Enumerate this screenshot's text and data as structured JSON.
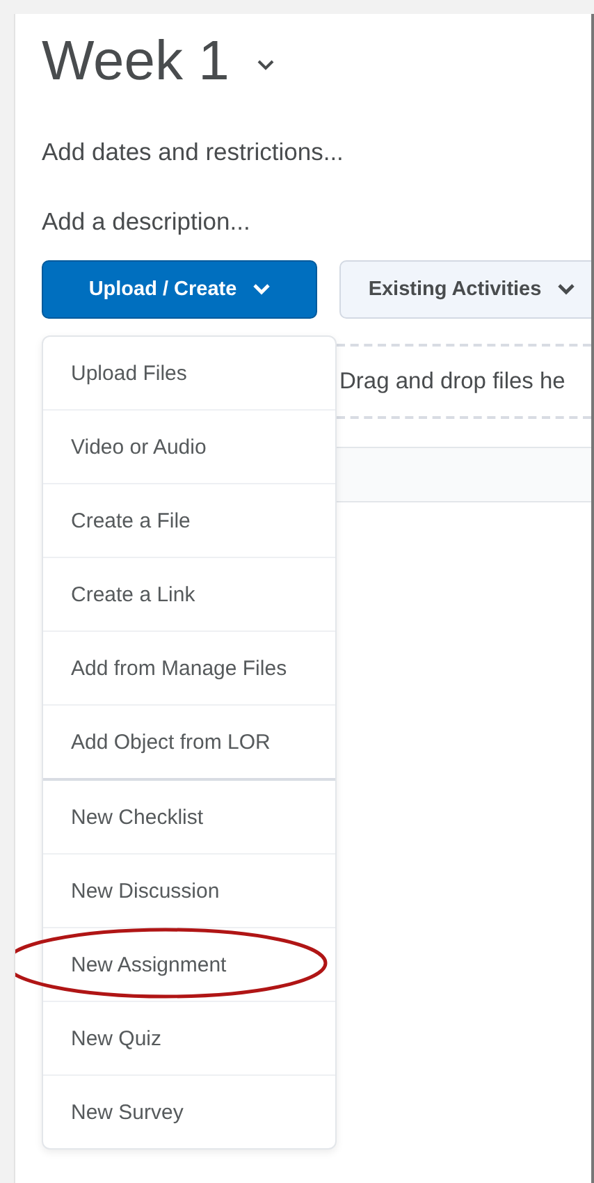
{
  "module": {
    "title": "Week 1",
    "dates_link": "Add dates and restrictions...",
    "description_link": "Add a description..."
  },
  "buttons": [
    {
      "label": "Upload / Create",
      "kind": "primary"
    },
    {
      "label": "Existing Activities",
      "kind": "secondary"
    }
  ],
  "dropzone": {
    "text": "Drag and drop files he"
  },
  "menu": [
    {
      "label": "Upload Files",
      "group_start": false,
      "highlighted": false
    },
    {
      "label": "Video or Audio",
      "group_start": false,
      "highlighted": false
    },
    {
      "label": "Create a File",
      "group_start": false,
      "highlighted": false
    },
    {
      "label": "Create a Link",
      "group_start": false,
      "highlighted": false
    },
    {
      "label": "Add from Manage Files",
      "group_start": false,
      "highlighted": false
    },
    {
      "label": "Add Object from LOR",
      "group_start": false,
      "highlighted": false
    },
    {
      "label": "New Checklist",
      "group_start": true,
      "highlighted": false
    },
    {
      "label": "New Discussion",
      "group_start": false,
      "highlighted": false
    },
    {
      "label": "New Assignment",
      "group_start": false,
      "highlighted": true
    },
    {
      "label": "New Quiz",
      "group_start": false,
      "highlighted": false
    },
    {
      "label": "New Survey",
      "group_start": false,
      "highlighted": false
    }
  ]
}
